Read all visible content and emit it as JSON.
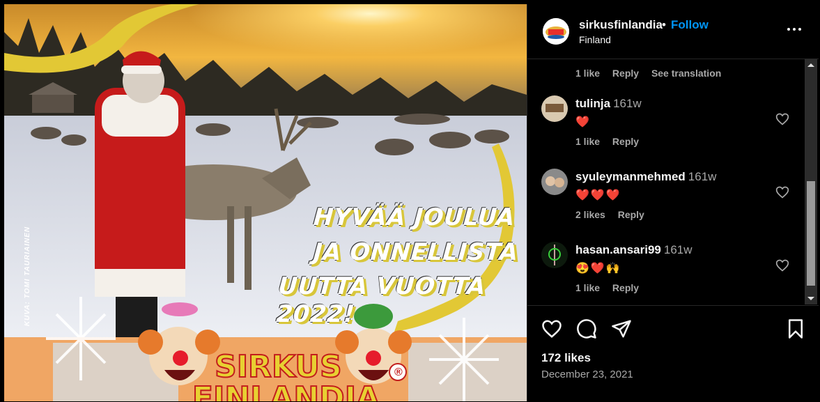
{
  "media": {
    "greeting_line1": "HYVÄÄ JOULUA",
    "greeting_line2": "JA ONNELLISTA",
    "greeting_line3": "UUTTA VUOTTA 2022!",
    "photo_credit": "KUVA: TOMI TAURIAINEN",
    "logo_line1": "SIRKUS",
    "logo_line2": "FINLANDIA",
    "logo_mark": "®"
  },
  "header": {
    "username": "sirkusfinlandia",
    "separator": "•",
    "follow_label": "Follow",
    "location": "Finland",
    "more_icon": "more-horizontal-icon"
  },
  "comments": {
    "top_meta": {
      "likes": "1 like",
      "reply": "Reply",
      "translation": "See translation"
    },
    "items": [
      {
        "user": "tulinja",
        "time": "161w",
        "text": "❤️",
        "likes": "1 like",
        "reply": "Reply"
      },
      {
        "user": "syuleymanmehmed",
        "time": "161w",
        "text": "❤️❤️❤️",
        "likes": "2 likes",
        "reply": "Reply"
      },
      {
        "user": "hasan.ansari99",
        "time": "161w",
        "text": "😍❤️🙌",
        "likes": "1 like",
        "reply": "Reply"
      }
    ]
  },
  "post": {
    "likes": "172 likes",
    "date": "December 23, 2021"
  },
  "colors": {
    "accent": "#0095f6",
    "heart": "#ff3040",
    "secondary_text": "#a8a8a8",
    "background": "#000000"
  }
}
